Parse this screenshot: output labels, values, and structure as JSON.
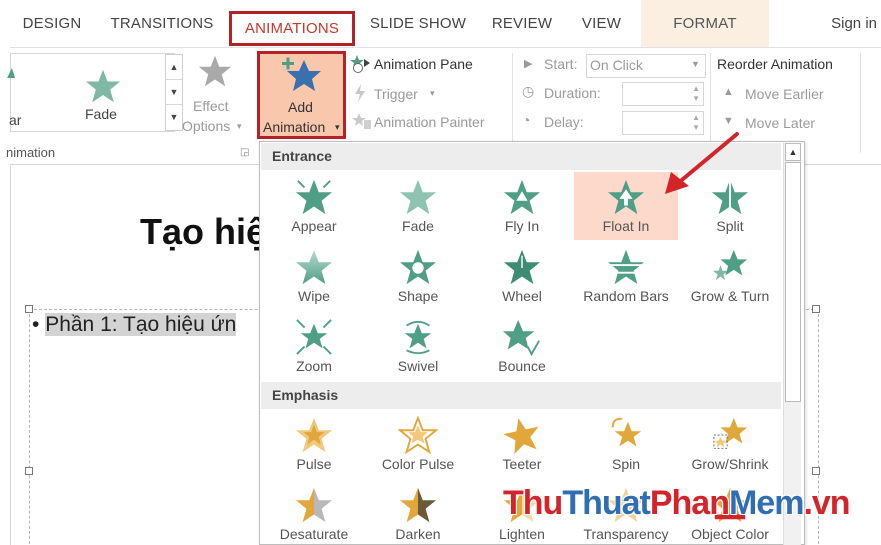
{
  "tabs": [
    {
      "label": "DESIGN"
    },
    {
      "label": "TRANSITIONS"
    },
    {
      "label": "ANIMATIONS"
    },
    {
      "label": "SLIDE SHOW"
    },
    {
      "label": "REVIEW"
    },
    {
      "label": "VIEW"
    },
    {
      "label": "FORMAT"
    }
  ],
  "signin": "Sign in",
  "ribbon": {
    "gallery_partial_label": "ar",
    "gallery_fade_label": "Fade",
    "effect_options_line1": "Effect",
    "effect_options_line2": "Options",
    "add_animation_line1": "Add",
    "add_animation_line2": "Animation",
    "animation_pane": "Animation Pane",
    "trigger": "Trigger",
    "animation_painter": "Animation Painter",
    "start_label": "Start:",
    "start_value": "On Click",
    "duration_label": "Duration:",
    "delay_label": "Delay:",
    "reorder_title": "Reorder Animation",
    "move_earlier": "Move Earlier",
    "move_later": "Move Later",
    "group_label": "nimation"
  },
  "slide": {
    "title_partial": "Tạo hiệ",
    "bullet_partial": "Phần 1: Tạo hiệu ứn"
  },
  "dropdown": {
    "entrance_header": "Entrance",
    "entrance_items": [
      "Appear",
      "Fade",
      "Fly In",
      "Float In",
      "Split",
      "Wipe",
      "Shape",
      "Wheel",
      "Random Bars",
      "Grow & Turn",
      "Zoom",
      "Swivel",
      "Bounce"
    ],
    "selected_item": "Float In",
    "emphasis_header": "Emphasis",
    "emphasis_items": [
      "Pulse",
      "Color Pulse",
      "Teeter",
      "Spin",
      "Grow/Shrink",
      "Desaturate",
      "Darken",
      "Lighten",
      "Transparency",
      "Object Color"
    ]
  },
  "watermark": {
    "part1": "Thu",
    "part2": "Thuat",
    "part3": "Phan",
    "part4": "Mem",
    "part5": ".vn"
  },
  "colors": {
    "accent_red": "#b32226",
    "entrance_green": "#4f9e86",
    "emphasis_gold": "#e2a73b",
    "selected_bg": "#fcd9cb"
  }
}
